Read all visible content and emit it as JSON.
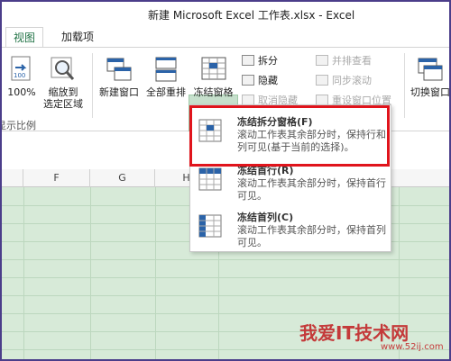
{
  "window": {
    "title": "新建 Microsoft Excel 工作表.xlsx - Excel"
  },
  "tabs": [
    {
      "label": "视图",
      "active": true
    },
    {
      "label": "加载项",
      "active": false
    }
  ],
  "ribbon": {
    "zoom_100": "100%",
    "zoom_to_selection_line1": "缩放到",
    "zoom_to_selection_line2": "选定区域",
    "new_window": "新建窗口",
    "arrange_all": "全部重排",
    "freeze_panes": "冻结窗格",
    "split": "拆分",
    "hide": "隐藏",
    "unhide": "取消隐藏",
    "view_side_by_side": "并排查看",
    "sync_scroll": "同步滚动",
    "reset_position": "重设窗口位置",
    "switch_windows": "切换窗口",
    "zoom_group_label": "显示比例"
  },
  "grid": {
    "columns": [
      "F",
      "G",
      "H"
    ]
  },
  "menu": {
    "items": [
      {
        "title": "冻结拆分窗格(F)",
        "desc": "滚动工作表其余部分时，保持行和列可见(基于当前的选择)。"
      },
      {
        "title": "冻结首行(R)",
        "desc": "滚动工作表其余部分时，保持首行可见。"
      },
      {
        "title": "冻结首列(C)",
        "desc": "滚动工作表其余部分时，保持首列可见。"
      }
    ]
  },
  "watermark": {
    "text": "我爱IT技术网",
    "url": "www.52ij.com"
  },
  "colors": {
    "accent": "#217346",
    "highlight": "#c6e0cc",
    "annotation": "#e0141c",
    "grid_bg": "#d7ead8"
  }
}
